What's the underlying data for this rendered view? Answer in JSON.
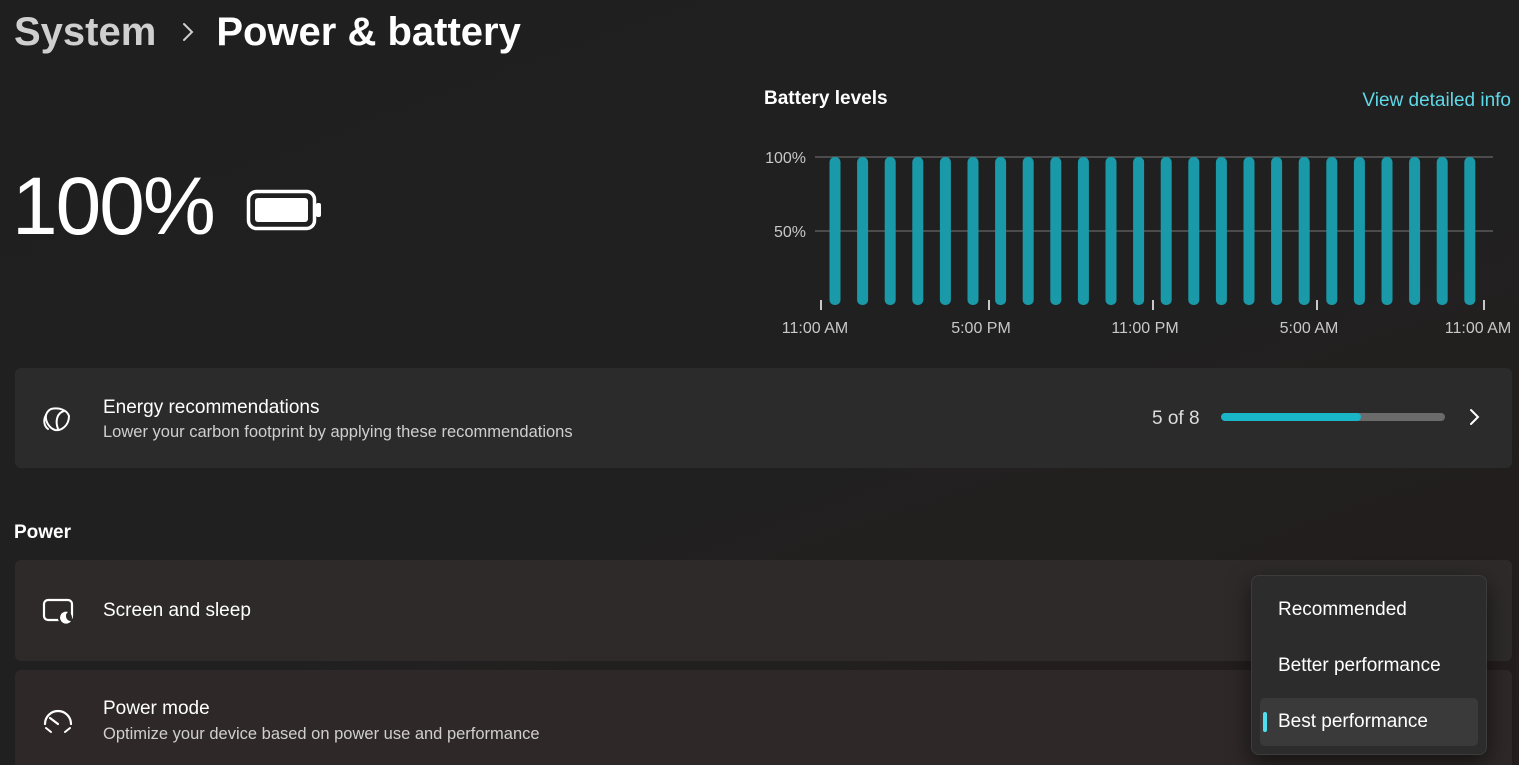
{
  "breadcrumb": {
    "parent": "System",
    "current": "Power & battery"
  },
  "battery": {
    "percent_label": "100%",
    "level": 1.0,
    "icon": "battery-full-icon"
  },
  "battery_chart": {
    "title": "Battery levels",
    "link": "View detailed info"
  },
  "chart_data": {
    "type": "bar",
    "ylim": [
      0,
      100
    ],
    "y_ticks": [
      "100%",
      "50%"
    ],
    "x_tick_labels": [
      "11:00 AM",
      "5:00 PM",
      "11:00 PM",
      "5:00 AM",
      "11:00 AM"
    ],
    "values": [
      100,
      100,
      100,
      100,
      100,
      100,
      100,
      100,
      100,
      100,
      100,
      100,
      100,
      100,
      100,
      100,
      100,
      100,
      100,
      100,
      100,
      100,
      100,
      100
    ],
    "grid": true,
    "color": "#1a9aa8"
  },
  "energy": {
    "icon": "leaf-icon",
    "title": "Energy recommendations",
    "subtitle": "Lower your carbon footprint by applying these recommendations",
    "count_label": "5 of 8",
    "progress": 0.625,
    "chevron": "chevron-right-icon"
  },
  "power_section": {
    "label": "Power",
    "screen_sleep": {
      "icon": "screen-sleep-icon",
      "title": "Screen and sleep"
    },
    "power_mode": {
      "icon": "gauge-icon",
      "title": "Power mode",
      "subtitle": "Optimize your device based on power use and performance"
    }
  },
  "power_mode_menu": {
    "options": [
      "Recommended",
      "Better performance",
      "Best performance"
    ],
    "selected": "Best performance"
  },
  "colors": {
    "accent": "#5fd8e8",
    "bar": "#1a9aa8",
    "progress": "#19b6c8"
  }
}
